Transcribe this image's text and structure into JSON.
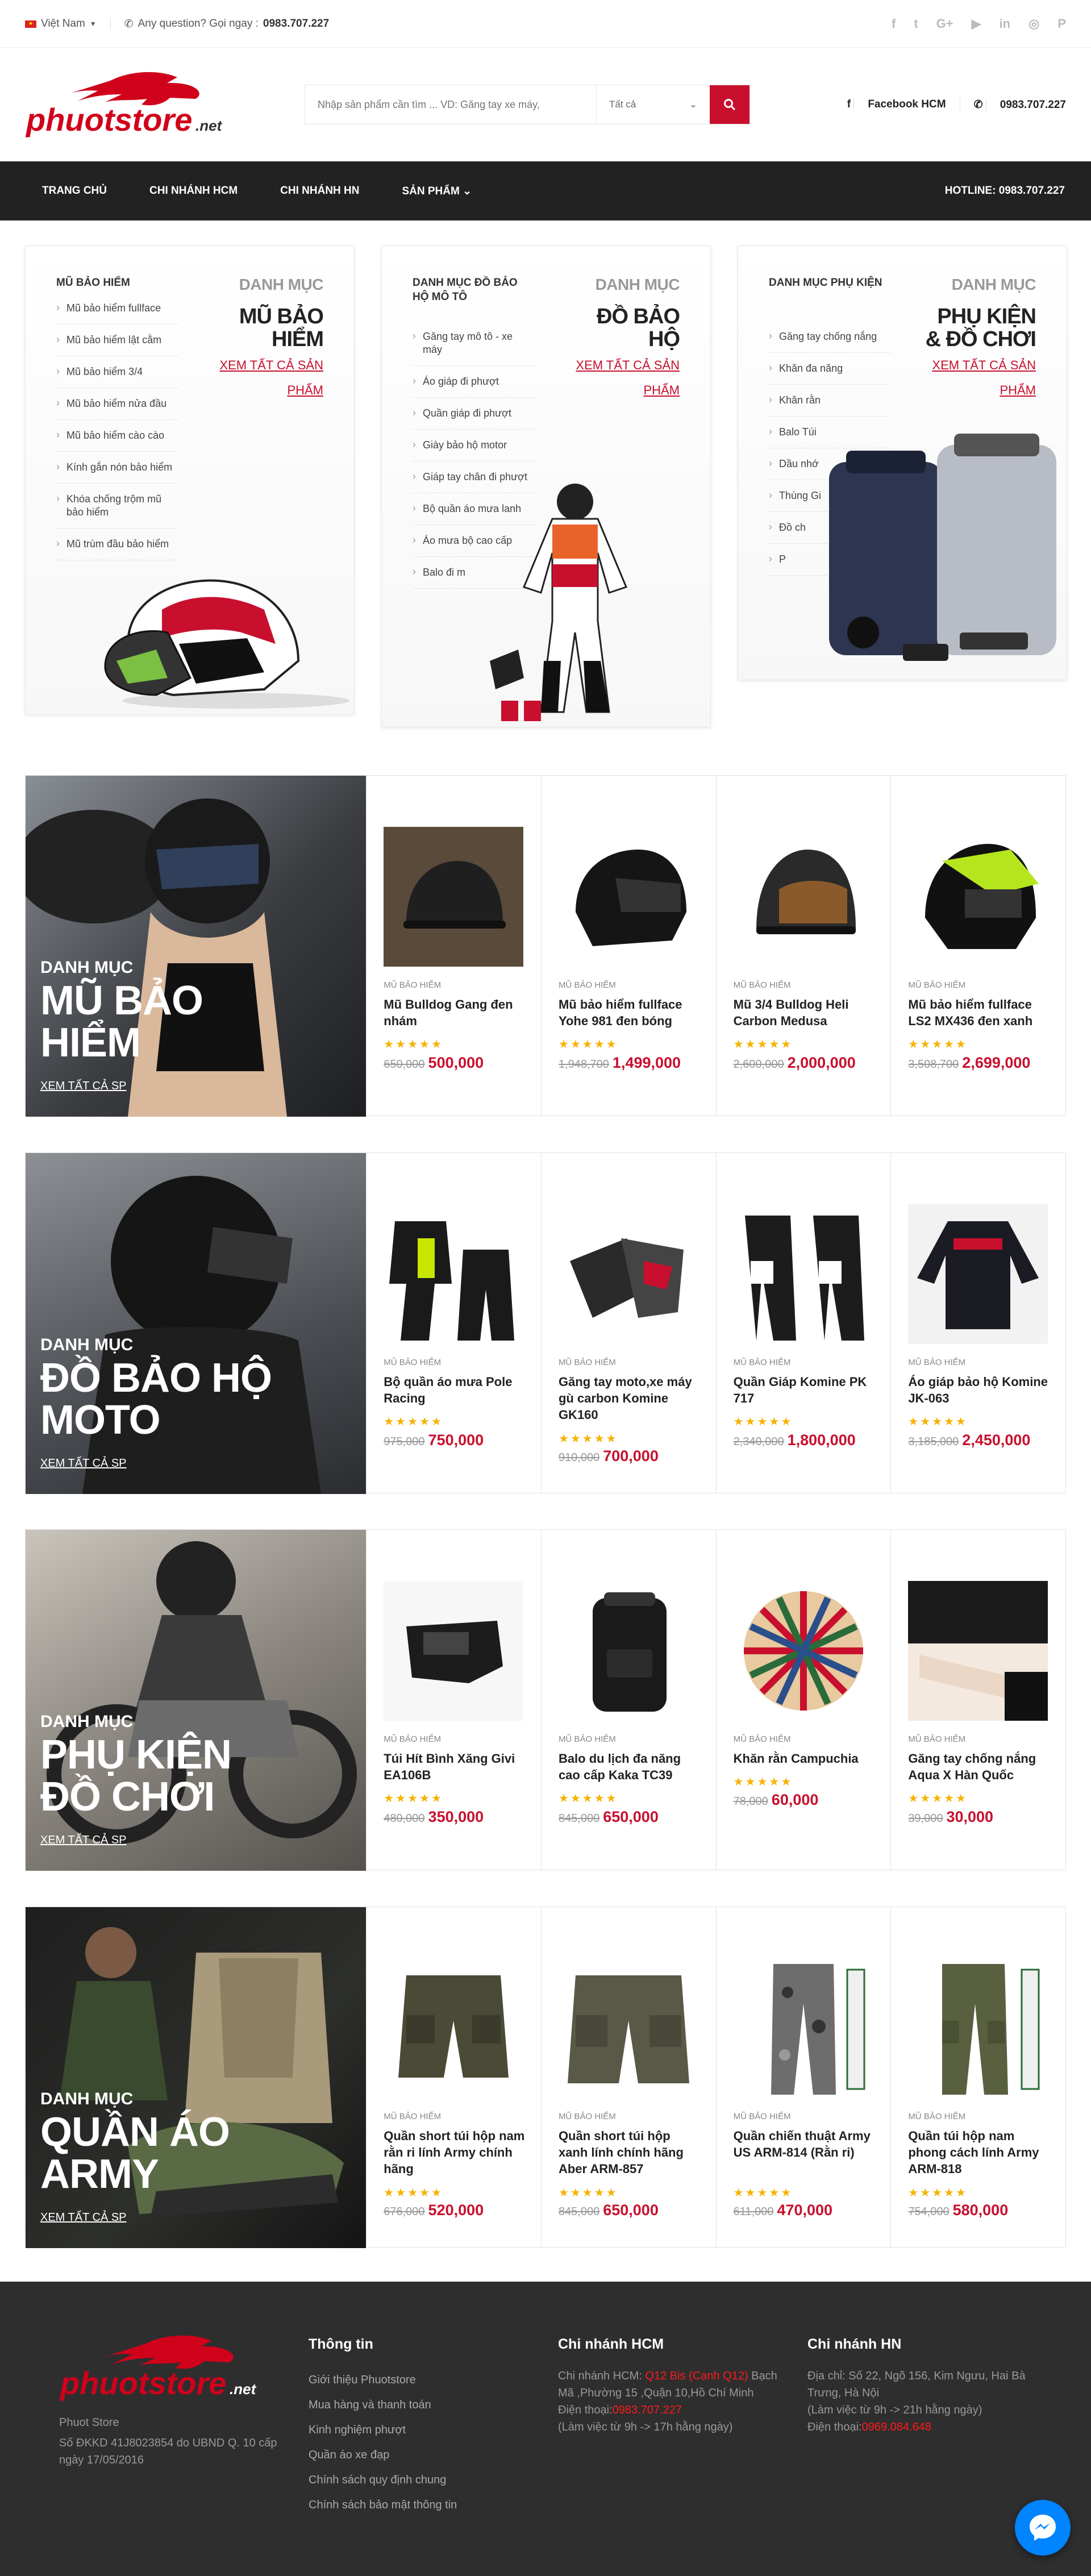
{
  "topbar": {
    "language": "Việt Nam",
    "question_prefix": "Any question? Gọi ngay : ",
    "question_phone": "0983.707.227",
    "socials": [
      "facebook-icon",
      "twitter-icon",
      "google-plus-icon",
      "youtube-icon",
      "linkedin-icon",
      "instagram-icon",
      "pinterest-icon"
    ]
  },
  "header": {
    "logo_main": "phuotstore",
    "logo_suffix": ".net",
    "search_placeholder": "Nhập sản phẩm cần tìm ... VD: Găng tay xe máy,",
    "search_category": "Tất cả",
    "facebook_label": "Facebook HCM",
    "phone_label": "0983.707.227"
  },
  "nav": {
    "items": [
      "TRANG CHỦ",
      "CHI NHÁNH HCM",
      "CHI NHÁNH HN",
      "SẢN PHẨM"
    ],
    "hotline": "HOTLINE: 0983.707.227"
  },
  "categories": [
    {
      "heading": "MŨ BẢO HIỂM",
      "label": "DANH MỤC",
      "title": "MŨ BẢO HIỂM",
      "link": "XEM TẤT CẢ SẢN PHẨM",
      "items": [
        "Mũ bảo hiểm fullface",
        "Mũ bảo hiểm lật cằm",
        "Mũ bảo hiểm 3/4",
        "Mũ bảo hiểm nửa đầu",
        "Mũ bảo hiểm cào cào",
        "Kính gắn nón bảo hiểm",
        "Khóa chống trộm mũ bảo hiểm",
        "Mũ trùm đầu bảo hiểm"
      ]
    },
    {
      "heading": "DANH MỤC ĐỒ BẢO HỘ MÔ TÔ",
      "label": "DANH MỤC",
      "title": "ĐỒ BẢO HỘ",
      "link": "XEM TẤT CẢ SẢN PHẨM",
      "items": [
        "Găng tay mô tô - xe máy",
        "Áo giáp đi phượt",
        "Quần giáp đi phượt",
        "Giày bảo hộ motor",
        "Giáp tay chân đi phượt",
        "Bộ quần áo mưa lanh",
        "Áo mưa bộ cao cấp",
        "Balo đi m"
      ]
    },
    {
      "heading": "DANH MỤC PHỤ KIỆN",
      "label": "DANH MỤC",
      "title": "PHỤ KIỆN & ĐỒ CHƠI",
      "link": "XEM TẤT CẢ SẢN PHẨM",
      "items": [
        "Găng tay chống nắng",
        "Khăn đa năng",
        "Khăn rằn",
        "Balo Túi",
        "Dầu nhớ",
        "Thùng Gi",
        "Đồ ch",
        "P"
      ]
    }
  ],
  "rows": [
    {
      "label": "DANH MỤC",
      "title": "MŨ BẢO HIỂM",
      "link": "XEM TẤT CẢ SP",
      "products": [
        {
          "cat": "MŨ BẢO HIỂM",
          "name": "Mũ Bulldog Gang đen nhám",
          "old": "650,000",
          "new": "500,000"
        },
        {
          "cat": "MŨ BẢO HIỂM",
          "name": "Mũ bảo hiểm fullface Yohe 981 đen bóng",
          "old": "1,948,700",
          "new": "1,499,000"
        },
        {
          "cat": "MŨ BẢO HIỂM",
          "name": "Mũ 3/4 Bulldog Heli Carbon Medusa",
          "old": "2,600,000",
          "new": "2,000,000"
        },
        {
          "cat": "MŨ BẢO HIỂM",
          "name": "Mũ bảo hiểm fullface LS2 MX436 đen xanh",
          "old": "3,508,700",
          "new": "2,699,000"
        }
      ]
    },
    {
      "label": "DANH MỤC",
      "title": "ĐỒ BẢO HỘ MOTO",
      "link": "XEM TẤT CẢ SP",
      "products": [
        {
          "cat": "MŨ BẢO HIỂM",
          "name": "Bộ quần áo mưa Pole Racing",
          "old": "975,000",
          "new": "750,000"
        },
        {
          "cat": "MŨ BẢO HIỂM",
          "name": "Găng tay moto,xe máy gù carbon Komine GK160",
          "old": "910,000",
          "new": "700,000"
        },
        {
          "cat": "MŨ BẢO HIỂM",
          "name": "Quần Giáp Komine PK 717",
          "old": "2,340,000",
          "new": "1,800,000"
        },
        {
          "cat": "MŨ BẢO HIỂM",
          "name": "Áo giáp bảo hộ Komine JK-063",
          "old": "3,185,000",
          "new": "2,450,000"
        }
      ]
    },
    {
      "label": "DANH MỤC",
      "title": "PHỤ KIỆN ĐỒ CHƠI",
      "link": "XEM TẤT CẢ SP",
      "products": [
        {
          "cat": "MŨ BẢO HIỂM",
          "name": "Túi Hít Bình Xăng Givi EA106B",
          "old": "480,000",
          "new": "350,000"
        },
        {
          "cat": "MŨ BẢO HIỂM",
          "name": "Balo du lịch đa năng cao cấp Kaka TC39",
          "old": "845,000",
          "new": "650,000"
        },
        {
          "cat": "MŨ BẢO HIỂM",
          "name": "Khăn rằn Campuchia",
          "old": "78,000",
          "new": "60,000"
        },
        {
          "cat": "MŨ BẢO HIỂM",
          "name": "Găng tay chống nắng Aqua X Hàn Quốc",
          "old": "39,000",
          "new": "30,000"
        }
      ]
    },
    {
      "label": "DANH MỤC",
      "title": "QUẦN ÁO ARMY",
      "link": "XEM TẤT CẢ SP",
      "products": [
        {
          "cat": "MŨ BẢO HIỂM",
          "name": "Quần short túi hộp nam rằn ri lính Army chính hãng",
          "old": "676,000",
          "new": "520,000"
        },
        {
          "cat": "MŨ BẢO HIỂM",
          "name": "Quần short túi hộp xanh lính chính hãng Aber ARM-857",
          "old": "845,000",
          "new": "650,000"
        },
        {
          "cat": "MŨ BẢO HIỂM",
          "name": "Quần chiến thuật Army US ARM-814 (Rằn ri)",
          "old": "611,000",
          "new": "470,000"
        },
        {
          "cat": "MŨ BẢO HIỂM",
          "name": "Quần túi hộp nam phong cách lính Army ARM-818",
          "old": "754,000",
          "new": "580,000"
        }
      ]
    }
  ],
  "footer": {
    "company": "Phuot Store",
    "license": "Số ĐKKD 41J8023854 do UBND Q. 10 cấp ngày 17/05/2016",
    "info_title": "Thông tin",
    "info_links": [
      "Giới thiệu Phuotstore",
      "Mua hàng và thanh toán",
      "Kinh nghiệm phượt",
      "Quần áo xe đạp",
      "Chính sách quy định chung",
      "Chính sách bảo mật thông tin"
    ],
    "hcm_title": "Chi nhánh HCM",
    "hcm_addr_prefix": "Chi nhánh HCM: ",
    "hcm_addr_highlight": "Q12 Bis (Cạnh Q12)",
    "hcm_addr_rest": " Bạch Mã ,Phường 15 ,Quận 10,Hồ Chí Minh",
    "hcm_phone_prefix": "Điện thoại:",
    "hcm_phone": "0983.707.227",
    "hcm_hours": "(Làm việc từ 9h -> 17h hằng ngày)",
    "hn_title": "Chi nhánh HN",
    "hn_addr": "Địa chỉ: Số 22, Ngõ 156, Kim Ngưu, Hai Bà Trưng, Hà Nội",
    "hn_hours": "(Làm việc từ 9h -> 21h hằng ngày)",
    "hn_phone_prefix": "Điện thoại:",
    "hn_phone": "0969.084.648"
  }
}
